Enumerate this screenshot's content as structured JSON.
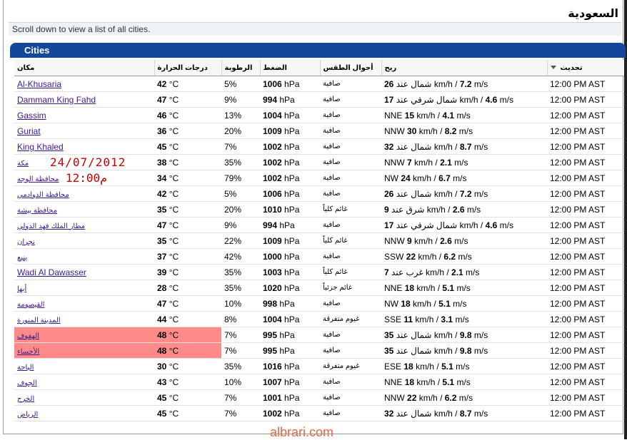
{
  "page": {
    "title": "السعودية",
    "hint": "Scroll down to view a list of all cities.",
    "panel_title": "Cities",
    "overlay_date": "24/07/2012",
    "overlay_time": "12:00م",
    "watermark": "albrari.com"
  },
  "columns": [
    "مكان",
    "درجات الحرارة",
    "الرطوبة",
    "الضغط",
    "أحوال الطقس",
    "ريح",
    "تحديث"
  ],
  "rows": [
    {
      "city": "Al-Khusaria",
      "en": true,
      "temp": "42",
      "hum": "5%",
      "pres": "1006",
      "cond": "صافية",
      "wind_dir": "شمال عند",
      "wind_kmh": "26",
      "wind_ms": "7.2",
      "updated": "12:00 PM AST"
    },
    {
      "city": "Dammam King Fahd",
      "en": true,
      "temp": "47",
      "hum": "9%",
      "pres": "994",
      "cond": "صافية",
      "wind_dir": "شمال شرقي عند",
      "wind_kmh": "17",
      "wind_ms": "4.6",
      "updated": "12:00 PM AST"
    },
    {
      "city": "Gassim",
      "en": true,
      "temp": "46",
      "hum": "13%",
      "pres": "1004",
      "cond": "صافية",
      "wind_dir": "NNE",
      "wind_kmh": "15",
      "wind_ms": "4.1",
      "updated": "12:00 PM AST"
    },
    {
      "city": "Guriat",
      "en": true,
      "temp": "36",
      "hum": "20%",
      "pres": "1009",
      "cond": "صافية",
      "wind_dir": "NNW",
      "wind_kmh": "30",
      "wind_ms": "8.2",
      "updated": "12:00 PM AST"
    },
    {
      "city": "King Khaled",
      "en": true,
      "temp": "45",
      "hum": "7%",
      "pres": "1002",
      "cond": "صافية",
      "wind_dir": "شمال عند",
      "wind_kmh": "32",
      "wind_ms": "8.7",
      "updated": "12:00 PM AST"
    },
    {
      "city": "مكة",
      "en": false,
      "temp": "38",
      "hum": "35%",
      "pres": "1002",
      "cond": "صافية",
      "wind_dir": "NNW",
      "wind_kmh": "7",
      "wind_ms": "2.1",
      "updated": "12:00 PM AST"
    },
    {
      "city": "محافظة الوجه",
      "en": false,
      "temp": "34",
      "hum": "79%",
      "pres": "1002",
      "cond": "صافية",
      "wind_dir": "NW",
      "wind_kmh": "24",
      "wind_ms": "6.7",
      "updated": "12:00 PM AST"
    },
    {
      "city": "محافظة الدوادمي",
      "en": false,
      "temp": "42",
      "hum": "5%",
      "pres": "1006",
      "cond": "صافية",
      "wind_dir": "شمال عند",
      "wind_kmh": "26",
      "wind_ms": "7.2",
      "updated": "12:00 PM AST"
    },
    {
      "city": "محافظة بيشة",
      "en": false,
      "temp": "35",
      "hum": "20%",
      "pres": "1010",
      "cond": "غائم كلياً",
      "wind_dir": "شرق عند",
      "wind_kmh": "9",
      "wind_ms": "2.6",
      "updated": "12:00 PM AST"
    },
    {
      "city": "مطار الملك فهد الدولي",
      "en": false,
      "temp": "47",
      "hum": "9%",
      "pres": "994",
      "cond": "صافية",
      "wind_dir": "شمال شرقي عند",
      "wind_kmh": "17",
      "wind_ms": "4.6",
      "updated": "12:00 PM AST"
    },
    {
      "city": "نجران",
      "en": false,
      "temp": "35",
      "hum": "22%",
      "pres": "1009",
      "cond": "غائم كلياً",
      "wind_dir": "NNW",
      "wind_kmh": "9",
      "wind_ms": "2.6",
      "updated": "12:00 PM AST"
    },
    {
      "city": "ينبع",
      "en": false,
      "temp": "37",
      "hum": "42%",
      "pres": "1000",
      "cond": "صافية",
      "wind_dir": "SSW",
      "wind_kmh": "22",
      "wind_ms": "6.2",
      "updated": "12:00 PM AST"
    },
    {
      "city": "Wadi Al Dawasser",
      "en": true,
      "temp": "39",
      "hum": "35%",
      "pres": "1003",
      "cond": "غائم كلياً",
      "wind_dir": "غرب عند",
      "wind_kmh": "7",
      "wind_ms": "2.1",
      "updated": "12:00 PM AST"
    },
    {
      "city": "أبها",
      "en": false,
      "temp": "28",
      "hum": "35%",
      "pres": "1020",
      "cond": "غائم جزئياً",
      "wind_dir": "NNE",
      "wind_kmh": "18",
      "wind_ms": "5.1",
      "updated": "12:00 PM AST"
    },
    {
      "city": "القيصومة",
      "en": false,
      "temp": "47",
      "hum": "10%",
      "pres": "998",
      "cond": "صافية",
      "wind_dir": "NW",
      "wind_kmh": "18",
      "wind_ms": "5.1",
      "updated": "12:00 PM AST"
    },
    {
      "city": "المدينة المنورة",
      "en": false,
      "temp": "44",
      "hum": "8%",
      "pres": "1004",
      "cond": "غيوم متفرقة",
      "wind_dir": "SSE",
      "wind_kmh": "11",
      "wind_ms": "3.1",
      "updated": "12:00 PM AST"
    },
    {
      "city": "الهفوف",
      "en": false,
      "temp": "48",
      "hum": "7%",
      "pres": "995",
      "cond": "صافية",
      "wind_dir": "شمال عند",
      "wind_kmh": "35",
      "wind_ms": "9.8",
      "updated": "12:00 PM AST",
      "highlight": true
    },
    {
      "city": "الأحساء",
      "en": false,
      "temp": "48",
      "hum": "7%",
      "pres": "995",
      "cond": "صافية",
      "wind_dir": "شمال عند",
      "wind_kmh": "35",
      "wind_ms": "9.8",
      "updated": "12:00 PM AST",
      "highlight": true
    },
    {
      "city": "الباحة",
      "en": false,
      "temp": "30",
      "hum": "35%",
      "pres": "1016",
      "cond": "غيوم متفرقة",
      "wind_dir": "ESE",
      "wind_kmh": "18",
      "wind_ms": "5.1",
      "updated": "12:00 PM AST"
    },
    {
      "city": "الجوف",
      "en": false,
      "temp": "43",
      "hum": "10%",
      "pres": "1007",
      "cond": "صافية",
      "wind_dir": "NNE",
      "wind_kmh": "18",
      "wind_ms": "5.1",
      "updated": "12:00 PM AST"
    },
    {
      "city": "الخرج",
      "en": false,
      "temp": "45",
      "hum": "7%",
      "pres": "1001",
      "cond": "صافية",
      "wind_dir": "NNW",
      "wind_kmh": "22",
      "wind_ms": "6.2",
      "updated": "12:00 PM AST"
    },
    {
      "city": "الرياض",
      "en": false,
      "temp": "45",
      "hum": "7%",
      "pres": "1002",
      "cond": "صافية",
      "wind_dir": "شمال عند",
      "wind_kmh": "32",
      "wind_ms": "8.7",
      "updated": "12:00 PM AST"
    }
  ],
  "units": {
    "temp": "°C",
    "pres": "hPa",
    "kmh": "km/h",
    "ms": "m/s"
  },
  "colors": {
    "header_blue": "#13479a",
    "highlight": "#ff8a8a",
    "overlay_red": "#c40000",
    "watermark": "#e06a40"
  }
}
